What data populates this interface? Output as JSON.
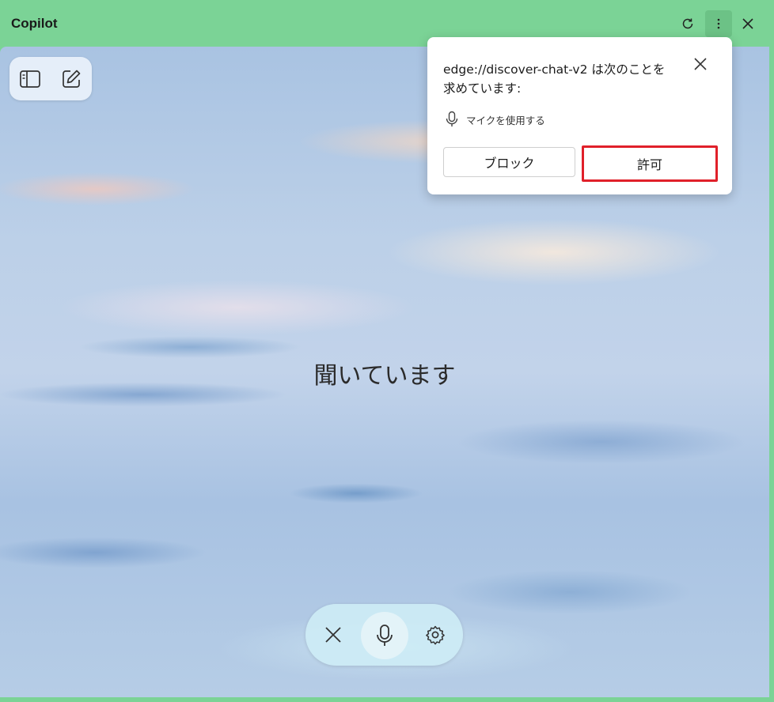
{
  "window": {
    "title": "Copilot"
  },
  "main": {
    "status_text": "聞いています"
  },
  "permission_popup": {
    "message": "edge://discover-chat-v2 は次のことを求めています:",
    "permission_label": "マイクを使用する",
    "block_label": "ブロック",
    "allow_label": "許可"
  },
  "icons": {
    "refresh": "refresh-icon",
    "more": "more-vertical-icon",
    "close": "close-icon",
    "sidebar": "sidebar-icon",
    "new_chat": "edit-icon",
    "mic": "microphone-icon",
    "settings": "gear-icon"
  },
  "colors": {
    "titlebar": "#7bd396",
    "allow_highlight": "#e0202a"
  }
}
